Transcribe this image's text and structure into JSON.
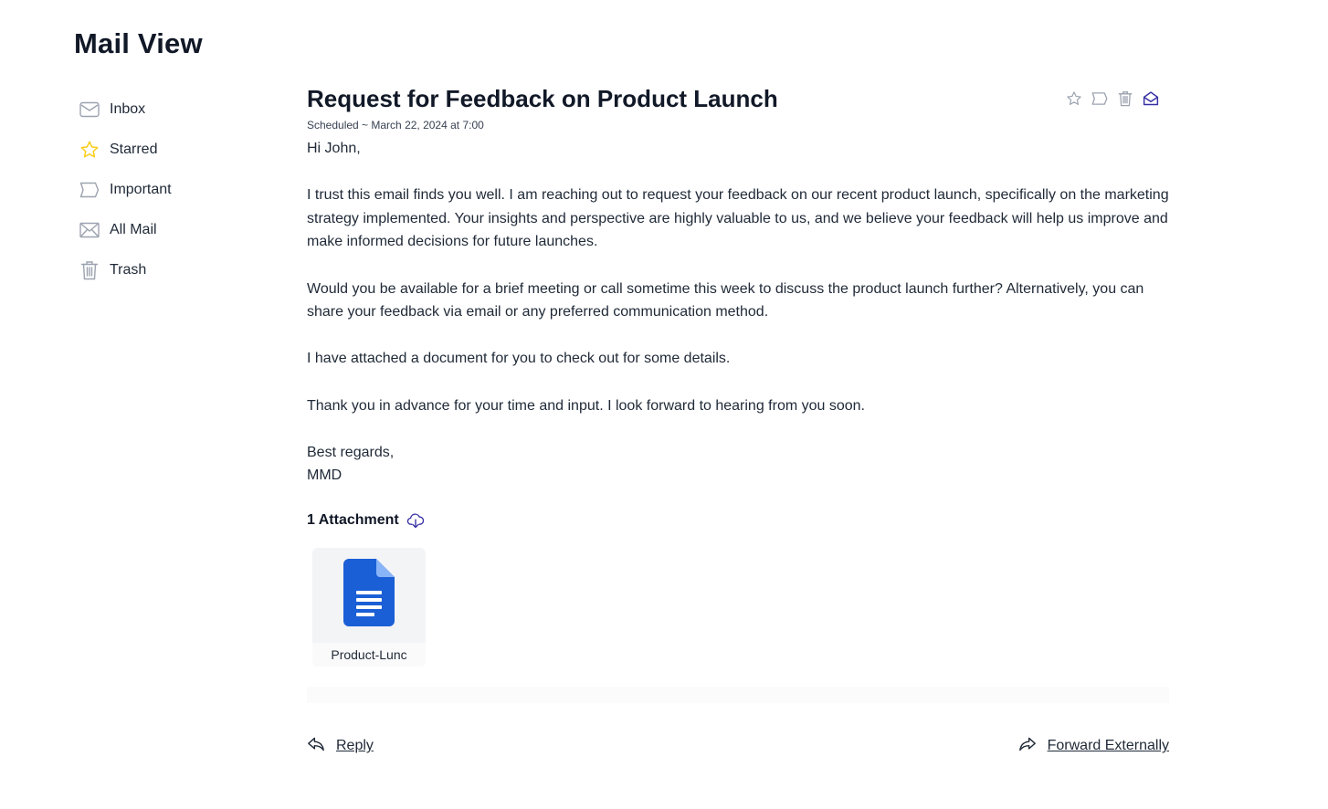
{
  "page": {
    "title": "Mail View"
  },
  "sidebar": {
    "items": [
      {
        "label": "Inbox",
        "icon": "inbox-icon"
      },
      {
        "label": "Starred",
        "icon": "star-icon"
      },
      {
        "label": "Important",
        "icon": "label-icon"
      },
      {
        "label": "All Mail",
        "icon": "mail-icon"
      },
      {
        "label": "Trash",
        "icon": "trash-icon"
      }
    ]
  },
  "email": {
    "subject": "Request for Feedback on Product Launch",
    "meta": "Scheduled ~ March 22, 2024 at 7:00",
    "greeting": "Hi John,",
    "paragraphs": [
      "I trust this email finds you well. I am reaching out to request your feedback on our recent product launch, specifically on the marketing strategy implemented. Your insights and perspective are highly valuable to us, and we believe your feedback will help us improve and make informed decisions for future launches.",
      "Would you be available for a brief meeting or call sometime this week to discuss the product launch further? Alternatively, you can share your feedback via email or any preferred communication method.",
      "I have attached a document for you to check out for some details.",
      "Thank you in advance for your time and input. I look forward to hearing from you soon."
    ],
    "closing": "Best regards,",
    "signature": "MMD"
  },
  "attachments": {
    "header": "1 Attachment",
    "items": [
      {
        "name": "Product-Lunc",
        "icon": "google-doc-icon"
      }
    ]
  },
  "footer": {
    "reply_label": "Reply",
    "forward_label": "Forward Externally"
  },
  "colors": {
    "accent": "#3730a3",
    "star": "#facc15",
    "doc_blue": "#1a73e8",
    "icon_gray": "#9ca3af"
  }
}
